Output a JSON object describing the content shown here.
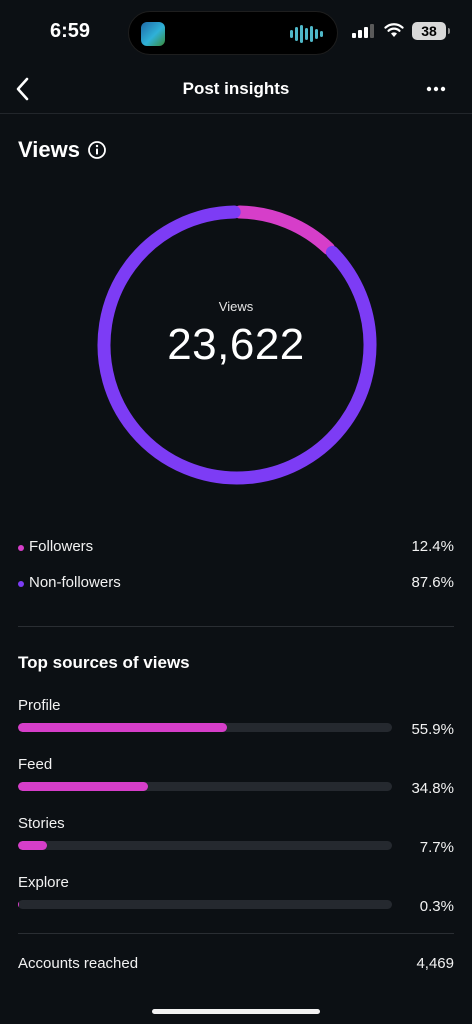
{
  "status_bar": {
    "time": "6:59",
    "battery": "38",
    "island_icon": "album-art-icon",
    "audio_icon": "audio-waveform-icon"
  },
  "nav": {
    "back_icon": "chevron-left-icon",
    "title": "Post insights",
    "more_icon": "more-horizontal-icon"
  },
  "views": {
    "title": "Views",
    "info_icon": "info-icon",
    "donut_label": "Views",
    "total": "23,622"
  },
  "colors": {
    "followers": "#d63ec9",
    "non_followers": "#7d3cf5",
    "bar_fill": "#d63ec9",
    "bar_track": "#25292f",
    "background": "#0c1014"
  },
  "breakdown": [
    {
      "label": "Followers",
      "percent": "12.4%",
      "value": 12.4
    },
    {
      "label": "Non-followers",
      "percent": "87.6%",
      "value": 87.6
    }
  ],
  "top_sources": {
    "title": "Top sources of views",
    "items": [
      {
        "label": "Profile",
        "percent": "55.9%",
        "value": 55.9
      },
      {
        "label": "Feed",
        "percent": "34.8%",
        "value": 34.8
      },
      {
        "label": "Stories",
        "percent": "7.7%",
        "value": 7.7
      },
      {
        "label": "Explore",
        "percent": "0.3%",
        "value": 0.3
      }
    ]
  },
  "accounts_reached": {
    "label": "Accounts reached",
    "value": "4,469"
  }
}
